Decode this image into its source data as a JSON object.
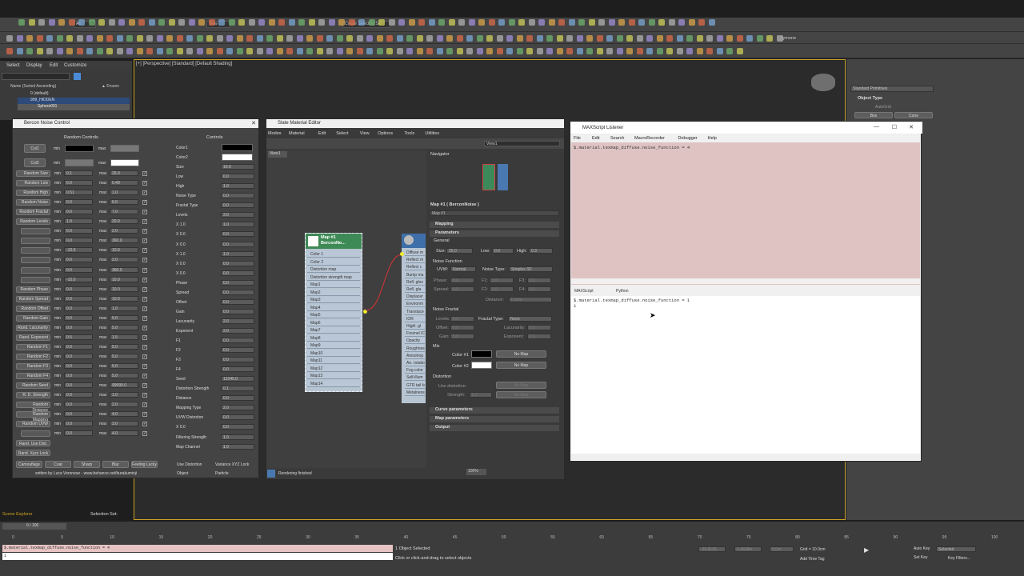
{
  "menubar": {
    "items": [
      "Select",
      "Display",
      "Edit",
      "Customize"
    ]
  },
  "toolbar": {
    "workspace_label": "All",
    "selection_set_label": "Create Selection Se",
    "view_label": "View",
    "user_label": "tymone"
  },
  "scene_explorer": {
    "header": "Name (Sorted Ascending)",
    "header_right": "▲ Frozen",
    "items": [
      "0 (default)",
      "999_HIDDEN",
      "Sphere001"
    ]
  },
  "viewport": {
    "label": "[+] [Perspective] [Standard] [Default Shading]"
  },
  "command_panel": {
    "dropdown": "Standard Primitives",
    "rollout": "Object Type",
    "autogrid": "AutoGrid",
    "btn_box": "Box",
    "btn_cone": "Cone"
  },
  "bercon": {
    "title": "Bercon Noise Control",
    "random_header": "Random Controls",
    "controls_header": "Controls",
    "col1": "Col1",
    "col2": "Col2",
    "min": "min",
    "max": "max",
    "random_rows": [
      {
        "label": "Random Size",
        "min": "0.1",
        "max": "25.0"
      },
      {
        "label": "Random Low",
        "min": "0.0",
        "max": "0.49"
      },
      {
        "label": "Random High",
        "min": "0.51",
        "max": "1.0"
      },
      {
        "label": "Random Noise",
        "min": "0.0",
        "max": "6.0"
      },
      {
        "label": "Random Fractal",
        "min": "0.0",
        "max": "7.0"
      },
      {
        "label": "Random Levels",
        "min": "1.0",
        "max": "20.0"
      },
      {
        "label": "",
        "min": "0.0",
        "max": "2.0"
      },
      {
        "label": "",
        "min": "0.0",
        "max": "360.0"
      },
      {
        "label": "",
        "min": "-10.0",
        "max": "10.0"
      },
      {
        "label": "",
        "min": "0.0",
        "max": "2.0"
      },
      {
        "label": "",
        "min": "0.0",
        "max": "360.0"
      },
      {
        "label": "",
        "min": "-10.0",
        "max": "10.0"
      },
      {
        "label": "Random Phase",
        "min": "0.0",
        "max": "10.0"
      },
      {
        "label": "Random Spread",
        "min": "0.0",
        "max": "10.0"
      },
      {
        "label": "Random Offset",
        "min": "0.0",
        "max": "1.0"
      },
      {
        "label": "Random Gain",
        "min": "0.0",
        "max": "5.0"
      },
      {
        "label": "Rand. Lacunarity",
        "min": "0.0",
        "max": "5.0"
      },
      {
        "label": "Rand. Exponent",
        "min": "0.5",
        "max": "1.5"
      },
      {
        "label": "Random F1",
        "min": "0.0",
        "max": "5.0"
      },
      {
        "label": "Random F2",
        "min": "0.0",
        "max": "5.0"
      },
      {
        "label": "Random F3",
        "min": "0.0",
        "max": "5.0"
      },
      {
        "label": "Random F4",
        "min": "0.0",
        "max": "5.0"
      },
      {
        "label": "Random Seed",
        "min": "0.0",
        "max": "99999.0"
      },
      {
        "label": "R. D. Strength",
        "min": "0.0",
        "max": "1.0"
      },
      {
        "label": "Random Distance",
        "min": "0.0",
        "max": "2.0"
      },
      {
        "label": "Random Mapping",
        "min": "0.0",
        "max": "4.0"
      },
      {
        "label": "Random UVW",
        "min": "0.0",
        "max": "3.0"
      },
      {
        "label": "",
        "min": "0.0",
        "max": "4.0"
      }
    ],
    "controls_rows": [
      {
        "label": "Color1",
        "value": ""
      },
      {
        "label": "Color2",
        "value": ""
      },
      {
        "label": "Size",
        "value": "10.0"
      },
      {
        "label": "Low",
        "value": "0.0"
      },
      {
        "label": "High",
        "value": "1.0"
      },
      {
        "label": "Noise Type",
        "value": "0.0"
      },
      {
        "label": "Fractal Type",
        "value": "0.0"
      },
      {
        "label": "Levels",
        "value": "3.0"
      },
      {
        "label": "X 1.0",
        "value": "1.0"
      },
      {
        "label": "X 0.0",
        "value": "0.0"
      },
      {
        "label": "X 0.0",
        "value": "0.0"
      },
      {
        "label": "X 1.0",
        "value": "1.0"
      },
      {
        "label": "X 0.0",
        "value": "0.0"
      },
      {
        "label": "X 0.0",
        "value": "0.0"
      },
      {
        "label": "Phase",
        "value": "0.0"
      },
      {
        "label": "Spread",
        "value": "0.0"
      },
      {
        "label": "Offset",
        "value": "0.0"
      },
      {
        "label": "Gain",
        "value": "0.0"
      },
      {
        "label": "Lacunarity",
        "value": "2.0"
      },
      {
        "label": "Exponent",
        "value": "2.0"
      },
      {
        "label": "F1",
        "value": "0.0"
      },
      {
        "label": "F2",
        "value": "0.0"
      },
      {
        "label": "F3",
        "value": "0.0"
      },
      {
        "label": "F4",
        "value": "0.0"
      },
      {
        "label": "Seed",
        "value": "12345.0"
      },
      {
        "label": "Distortion Strength",
        "value": "0.1"
      },
      {
        "label": "Distance",
        "value": "0.0"
      },
      {
        "label": "Mapping Type",
        "value": "2.0"
      },
      {
        "label": "UVW Distortion",
        "value": "0.0"
      },
      {
        "label": "X 0.0",
        "value": "0.0"
      },
      {
        "label": "Filtering Strength",
        "value": "1.0"
      },
      {
        "label": "Map Channel",
        "value": "1.0"
      }
    ],
    "buttons_left": [
      "Rand. Use Dist.",
      "Rand. Xyzz Lock"
    ],
    "bottom_buttons": [
      "Camouflage",
      "Coat",
      "Sharp",
      "Blur",
      "Feeling Lucky"
    ],
    "chk_use_distortion": "Use Distortion",
    "chk_variance": "Variance XYZ Lock",
    "chk_object": "Object",
    "chk_particle": "Particle",
    "credit": "written by Luca Veronese - www.behance.net/burakuminji"
  },
  "slate": {
    "title": "Slate Material Editor",
    "menu": [
      "Modes",
      "Material",
      "Edit",
      "Select",
      "View",
      "Options",
      "Tools",
      "Utilities"
    ],
    "view_tab": "View1",
    "view_dropdown": "View1",
    "navigator": "Navigator",
    "node_title": "Map #1",
    "node_sub": "BerconNo...",
    "ports": [
      "Color 1",
      "Color 2",
      "Distortion map",
      "Distortion strength map",
      "Map1",
      "Map2",
      "Map3",
      "Map4",
      "Map5",
      "Map6",
      "Map7",
      "Map8",
      "Map9",
      "Map10",
      "Map11",
      "Map12",
      "Map13",
      "Map14"
    ],
    "mat_ports": [
      "Diffuse m",
      "Reflect m",
      "Reflect c",
      "Bump ma",
      "Refl. glos",
      "Refl. gla",
      "Displacer",
      "Environm",
      "Transluce",
      "IOR",
      "Highl. gl",
      "Fresnel IC",
      "Opacity",
      "Roughnes",
      "Anisotrop",
      "An. rotatio",
      "Fog color",
      "Self-illum",
      "GTR tail fa",
      "Metalness"
    ],
    "status": "Rendering finished",
    "zoom": "100%",
    "params_title": "Map #1  ( BerconNoise )",
    "params_name": "Map #1",
    "rollouts": [
      "Mapping",
      "Parameters"
    ],
    "general": "General",
    "size_label": "Size:",
    "size_val": "25.0",
    "low_label": "Low:",
    "low_val": "0.0",
    "high_label": "High:",
    "high_val": "0.3",
    "noise_function": "Noise Function",
    "uvw_label": "UVW:",
    "uvw_val": "Normal",
    "noise_type_label": "Noise Type:",
    "noise_type_val": "Simplex 3D",
    "phase_label": "Phase:",
    "phase_val": "0.0",
    "f1_label": "F1:",
    "f1_val": "1.0",
    "f3_label": "F3:",
    "f3_val": "0.0",
    "spread_label": "Spread:",
    "spread_val": "0.0",
    "f2_label": "F2:",
    "f2_val": "0.0",
    "f4_label": "F4:",
    "f4_val": "0.0",
    "distance_label": "Distance:",
    "distance_val": "Linear",
    "noise_fractal": "Noise Fractal",
    "levels_label": "Levels:",
    "levels_val": "3.0",
    "fractal_type_label": "Fractal Type:",
    "fractal_type_val": "None",
    "offset_label": "Offset:",
    "offset_val": "0.0",
    "lacunarity_label": "Lacunarity:",
    "lacunarity_val": "2.0",
    "gain_label": "Gain:",
    "gain_val": "5.0",
    "exponent_label": "Exponent:",
    "exponent_val": "2.0",
    "mix": "Mix",
    "color1_label": "Color #1",
    "color2_label": "Color #2",
    "no_map": "No Map",
    "distortion": "Distortion",
    "use_distortion": "Use distortion:",
    "strength_label": "Strength:",
    "strength_val": "0.1",
    "rollouts_bottom": [
      "Curve parameters",
      "Map parameters",
      "Output"
    ]
  },
  "listener": {
    "title": "MAXScript Listener",
    "menu": [
      "File",
      "Edit",
      "Search",
      "MacroRecorder",
      "Debugger",
      "Help"
    ],
    "top_line": "$.material.texmap_diffuse.noise_function = 4",
    "tabs": [
      "MAXScript",
      "Python"
    ],
    "bottom_lines": [
      "$.material.texmap_diffuse.noise_function = 1",
      "1"
    ]
  },
  "status": {
    "scene_explorer_label": "Scene Explorer",
    "selection_set": "Selection Set:",
    "frame": "0 / 100",
    "mini_listener_line1": "$.material.texmap_diffuse.noise_function = 4",
    "mini_listener_line2": "1",
    "objects_selected": "1 Object Selected",
    "prompt": "Click or click-and-drag to select objects",
    "x_val": "-20.8195",
    "y_val": "0.4658m",
    "z_val": "0.0m",
    "grid": "Grid = 10.0cm",
    "add_time_tag": "Add Time Tag",
    "auto_key": "Auto Key",
    "set_key": "Set Key",
    "selected": "Selected",
    "key_filters": "Key Filters...",
    "ticks": [
      "0",
      "5",
      "10",
      "15",
      "20",
      "25",
      "30",
      "35",
      "40",
      "45",
      "50",
      "55",
      "60",
      "65",
      "70",
      "75",
      "80",
      "85",
      "90",
      "95",
      "100"
    ]
  }
}
